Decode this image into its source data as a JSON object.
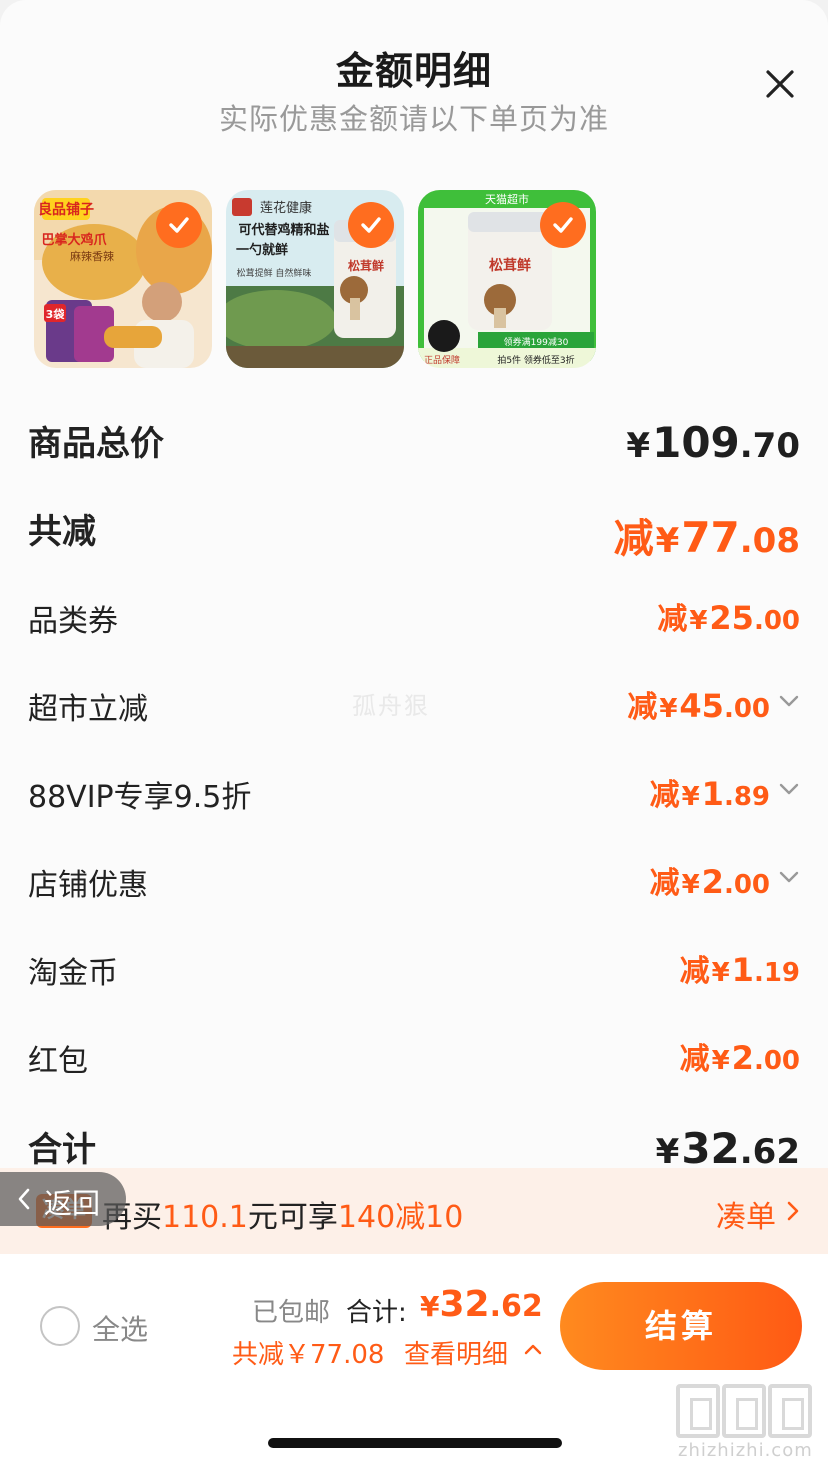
{
  "header": {
    "title": "金额明细",
    "subtitle": "实际优惠金额请以下单页为准"
  },
  "products": [
    {
      "brand": "良品铺子",
      "text_1": "巴掌大鸡爪",
      "text_2": "麻辣香辣",
      "badge": "3袋"
    },
    {
      "brand": "莲花健康",
      "text_1": "可代替鸡精和盐",
      "text_2": "一勺就鲜",
      "text_3": "松茸提鲜 自然鲜味",
      "product_name": "松茸鲜"
    },
    {
      "brand": "天猫超市",
      "product_name": "松茸鲜",
      "promo_1": "领券满199减30",
      "promo_2": "拍5件 领券低至3折",
      "guarantee": "正品保障"
    }
  ],
  "summary": {
    "rows": [
      {
        "label": "商品总价",
        "prefix": "",
        "currency": "¥",
        "int": "109",
        "dec": ".70",
        "style": "big-dark"
      },
      {
        "label": "共减",
        "prefix": "减",
        "currency": "¥",
        "int": "77",
        "dec": ".08",
        "style": "big"
      },
      {
        "label": "品类券",
        "prefix": "减",
        "currency": "¥",
        "int": "25",
        "dec": ".00"
      },
      {
        "label": "超市立减",
        "prefix": "减",
        "currency": "¥",
        "int": "45",
        "dec": ".00",
        "expandable": true
      },
      {
        "label": "88VIP专享9.5折",
        "prefix": "减",
        "currency": "¥",
        "int": "1",
        "dec": ".89",
        "expandable": true
      },
      {
        "label": "店铺优惠",
        "prefix": "减",
        "currency": "¥",
        "int": "2",
        "dec": ".00",
        "expandable": true
      },
      {
        "label": "淘金币",
        "prefix": "减",
        "currency": "¥",
        "int": "1",
        "dec": ".19"
      },
      {
        "label": "红包",
        "prefix": "减",
        "currency": "¥",
        "int": "2",
        "dec": ".00"
      },
      {
        "label": "合计",
        "prefix": "",
        "currency": "¥",
        "int": "32",
        "dec": ".62",
        "style": "big-dark"
      }
    ],
    "watermark": "孤舟狠"
  },
  "promo_bar": {
    "tag": "凑单",
    "text_a": "再买",
    "amount": "110.1",
    "text_b": "元可享",
    "deal": "140减10",
    "link": "凑单"
  },
  "back_button": {
    "label": "返回"
  },
  "footer": {
    "select_all": "全选",
    "shipping": "已包邮",
    "total_label": "合计:",
    "total_currency": "¥",
    "total_int": "32",
    "total_dec": ".62",
    "saved": "共减￥77.08",
    "detail_link": "查看明细",
    "checkout": "结算"
  },
  "site": {
    "url": "zhizhizhi.com"
  },
  "colors": {
    "accent": "#ff5b16",
    "button_start": "#ff8a1f",
    "button_end": "#ff5a14",
    "promo_bg": "#fdf0e8"
  }
}
